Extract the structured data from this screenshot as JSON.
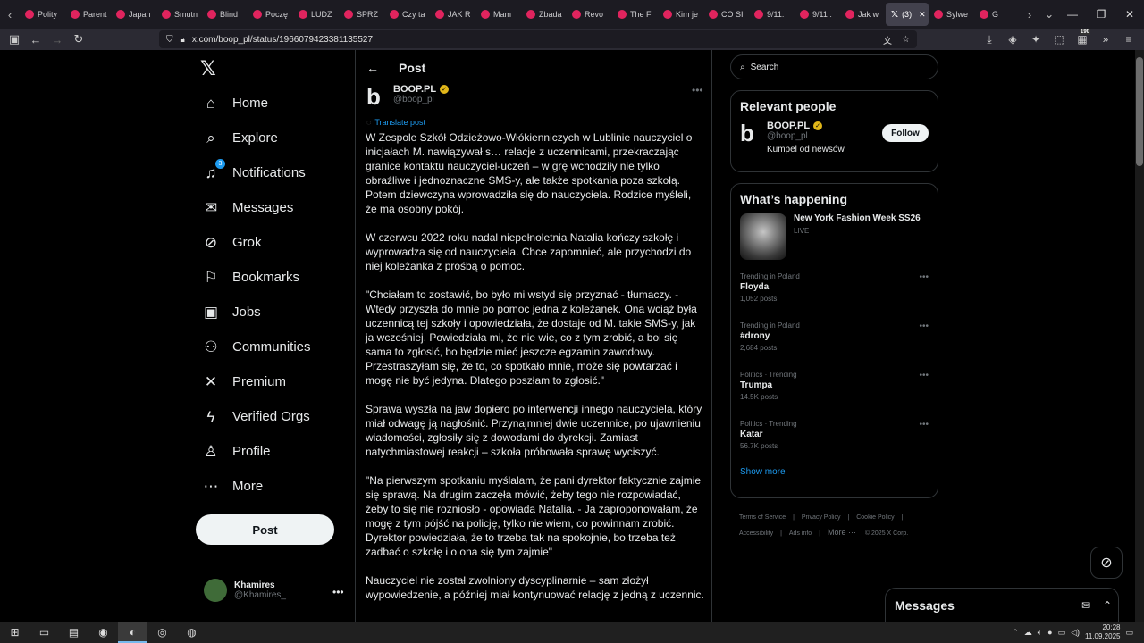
{
  "browser": {
    "tabs": [
      {
        "label": "Polity",
        "color": "#e0245e"
      },
      {
        "label": "Parent",
        "color": "#e0245e"
      },
      {
        "label": "Japan",
        "color": "#e0245e"
      },
      {
        "label": "Smutn",
        "color": "#e0245e"
      },
      {
        "label": "Blind",
        "color": "#e0245e"
      },
      {
        "label": "Poczę",
        "color": "#e0245e"
      },
      {
        "label": "LUDZ",
        "color": "#e0245e"
      },
      {
        "label": "SPRZ",
        "color": "#e0245e"
      },
      {
        "label": "Czy ta",
        "color": "#e0245e"
      },
      {
        "label": "JAK R",
        "color": "#e0245e"
      },
      {
        "label": "Mam",
        "color": "#e0245e"
      },
      {
        "label": "Zbada",
        "color": "#e0245e"
      },
      {
        "label": "Revo",
        "color": "#e0245e"
      },
      {
        "label": "The F",
        "color": "#e0245e"
      },
      {
        "label": "Kim je",
        "color": "#e0245e"
      },
      {
        "label": "CO SI",
        "color": "#e0245e"
      },
      {
        "label": "9/11:",
        "color": "#e0245e"
      },
      {
        "label": "9/11 :",
        "color": "#e0245e"
      },
      {
        "label": "Jak w",
        "color": "#e0245e"
      }
    ],
    "active_tab": {
      "label": "(3)"
    },
    "tabs_after": [
      {
        "label": "Sylwe",
        "color": "#e0245e"
      },
      {
        "label": "G",
        "color": "#e0245e"
      }
    ],
    "url": "x.com/boop_pl/status/1966079423381135527",
    "extension_badge": "190"
  },
  "sidebar": {
    "items": [
      {
        "label": "Home",
        "icon": "home-icon"
      },
      {
        "label": "Explore",
        "icon": "search-icon"
      },
      {
        "label": "Notifications",
        "icon": "bell-icon",
        "badge": "3"
      },
      {
        "label": "Messages",
        "icon": "envelope-icon"
      },
      {
        "label": "Grok",
        "icon": "grok-icon"
      },
      {
        "label": "Bookmarks",
        "icon": "bookmark-icon"
      },
      {
        "label": "Jobs",
        "icon": "briefcase-icon"
      },
      {
        "label": "Communities",
        "icon": "people-icon"
      },
      {
        "label": "Premium",
        "icon": "x-icon"
      },
      {
        "label": "Verified Orgs",
        "icon": "lightning-icon"
      },
      {
        "label": "Profile",
        "icon": "person-icon"
      },
      {
        "label": "More",
        "icon": "more-circle-icon"
      }
    ],
    "post_button": "Post",
    "account": {
      "name": "Khamires",
      "handle": "@Khamires_"
    }
  },
  "post": {
    "header_title": "Post",
    "author_name": "BOOP.PL",
    "author_handle": "@boop_pl",
    "translate_label": "Translate post",
    "paragraphs": [
      "W Zespole Szkół Odzieżowo-Włókienniczych w Lublinie nauczyciel o inicjałach M. nawiązywał s… relacje z uczennicami, przekraczając granice kontaktu nauczyciel-uczeń – w grę wchodziły nie tylko obraźliwe i jednoznaczne SMS-y, ale także spotkania poza szkołą. Potem dziewczyna wprowadziła się do nauczyciela. Rodzice myśleli, że ma osobny pokój.",
      "W czerwcu 2022 roku nadal niepełnoletnia Natalia kończy szkołę i wyprowadza się od nauczyciela. Chce zapomnieć, ale przychodzi do niej koleżanka z prośbą o pomoc.",
      "\"Chciałam to zostawić, bo było mi wstyd się przyznać - tłumaczy. - Wtedy przyszła do mnie po pomoc jedna z koleżanek. Ona wciąż była uczennicą tej szkoły i opowiedziała, że dostaje od M. takie SMS-y, jak ja wcześniej. Powiedziała mi, że nie wie, co z tym zrobić, a boi się sama to zgłosić, bo będzie mieć jeszcze egzamin zawodowy. Przestraszyłam się, że to, co spotkało mnie, może się powtarzać i mogę nie być jedyna. Dlatego poszłam to zgłosić.\"",
      "Sprawa wyszła na jaw dopiero po interwencji innego nauczyciela, który miał odwagę ją nagłośnić. Przynajmniej dwie uczennice, po ujawnieniu wiadomości, zgłosiły się z dowodami do dyrekcji. Zamiast natychmiastowej reakcji – szkoła próbowała sprawę wyciszyć.",
      "\"Na pierwszym spotkaniu myślałam, że pani dyrektor faktycznie zajmie się sprawą. Na drugim zaczęła mówić, żeby tego nie rozpowiadać, żeby to się nie rozniosło - opowiada Natalia. - Ja zaproponowałam, że mogę z tym pójść na policję, tylko nie wiem, co powinnam zrobić. Dyrektor powiedziała, że to trzeba tak na spokojnie, bo trzeba też zadbać o szkołę i o ona się tym zajmie\"",
      "Nauczyciel nie został zwolniony dyscyplinarnie – sam złożył wypowiedzenie, a później miał kontynuować relację z jedną z uczennic."
    ]
  },
  "right": {
    "search_placeholder": "Search",
    "relevant_title": "Relevant people",
    "relevant": {
      "name": "BOOP.PL",
      "handle": "@boop_pl",
      "bio": "Kumpel od newsów",
      "follow_label": "Follow"
    },
    "happening_title": "What’s happening",
    "event": {
      "title": "New York Fashion Week SS26",
      "status": "LIVE"
    },
    "trends": [
      {
        "context": "Trending in Poland",
        "name": "Floyda",
        "count": "1,052 posts"
      },
      {
        "context": "Trending in Poland",
        "name": "#drony",
        "count": "2,684 posts"
      },
      {
        "context": "Politics · Trending",
        "name": "Trumpa",
        "count": "14.5K posts"
      },
      {
        "context": "Politics · Trending",
        "name": "Katar",
        "count": "56.7K posts"
      }
    ],
    "show_more": "Show more",
    "footer": {
      "terms": "Terms of Service",
      "privacy": "Privacy Policy",
      "cookie": "Cookie Policy",
      "accessibility": "Accessibility",
      "ads": "Ads info",
      "more": "More ···",
      "copyright": "© 2025 X Corp."
    }
  },
  "messages_drawer": {
    "title": "Messages"
  },
  "taskbar": {
    "time": "20:28",
    "date": "11.09.2025"
  }
}
